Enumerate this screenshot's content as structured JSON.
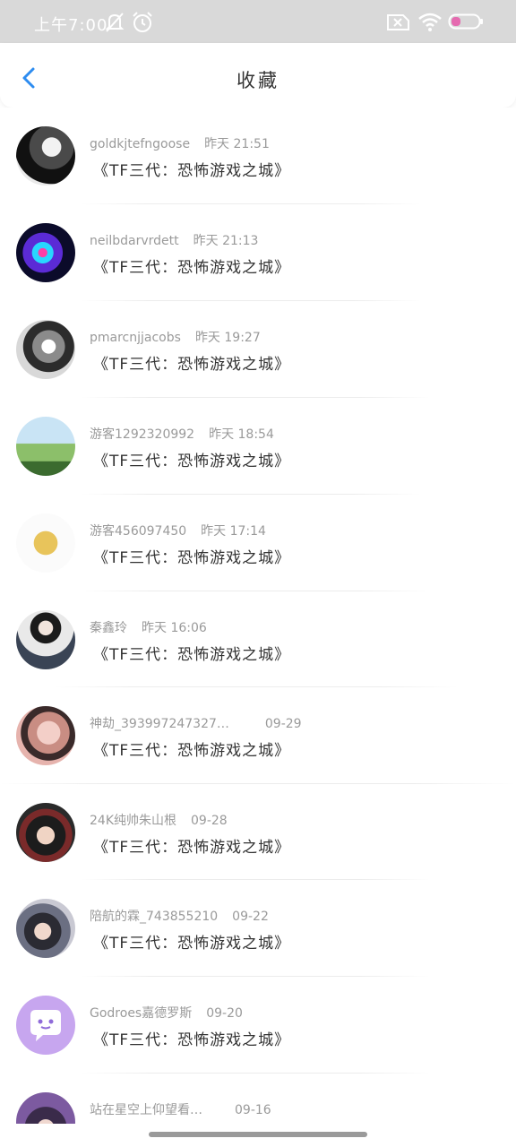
{
  "status": {
    "time": "上午7:00",
    "icons": [
      "bell-off-icon",
      "alarm-icon",
      "sim-disabled-icon",
      "wifi-icon",
      "battery-icon"
    ]
  },
  "header": {
    "title": "收藏",
    "back_icon": "chevron-left-icon"
  },
  "colors": {
    "accent": "#2d8cf0",
    "status_bar": "#d9d9d9",
    "battery": "#e56bb0"
  },
  "items": [
    {
      "user": "goldkjtefngoose",
      "time": "昨天 21:51",
      "message": "《TF三代：恐怖游戏之城》"
    },
    {
      "user": "neilbdarvrdett",
      "time": "昨天 21:13",
      "message": "《TF三代：恐怖游戏之城》"
    },
    {
      "user": "pmarcnjjacobs",
      "time": "昨天 19:27",
      "message": "《TF三代：恐怖游戏之城》"
    },
    {
      "user": "游客1292320992",
      "time": "昨天 18:54",
      "message": "《TF三代：恐怖游戏之城》"
    },
    {
      "user": "游客456097450",
      "time": "昨天 17:14",
      "message": "《TF三代：恐怖游戏之城》"
    },
    {
      "user": "秦鑫玲",
      "time": "昨天 16:06",
      "message": "《TF三代：恐怖游戏之城》"
    },
    {
      "user": "神劫_393997247327…",
      "time": "09-29",
      "message": "《TF三代：恐怖游戏之城》"
    },
    {
      "user": "24K纯帅朱山根",
      "time": "09-28",
      "message": "《TF三代：恐怖游戏之城》"
    },
    {
      "user": "陪航的霖_743855210",
      "time": "09-22",
      "message": "《TF三代：恐怖游戏之城》"
    },
    {
      "user": "Godroes嘉德罗斯",
      "time": "09-20",
      "message": "《TF三代：恐怖游戏之城》"
    },
    {
      "user": "站在星空上仰望看…",
      "time": "09-16",
      "message": ""
    }
  ]
}
